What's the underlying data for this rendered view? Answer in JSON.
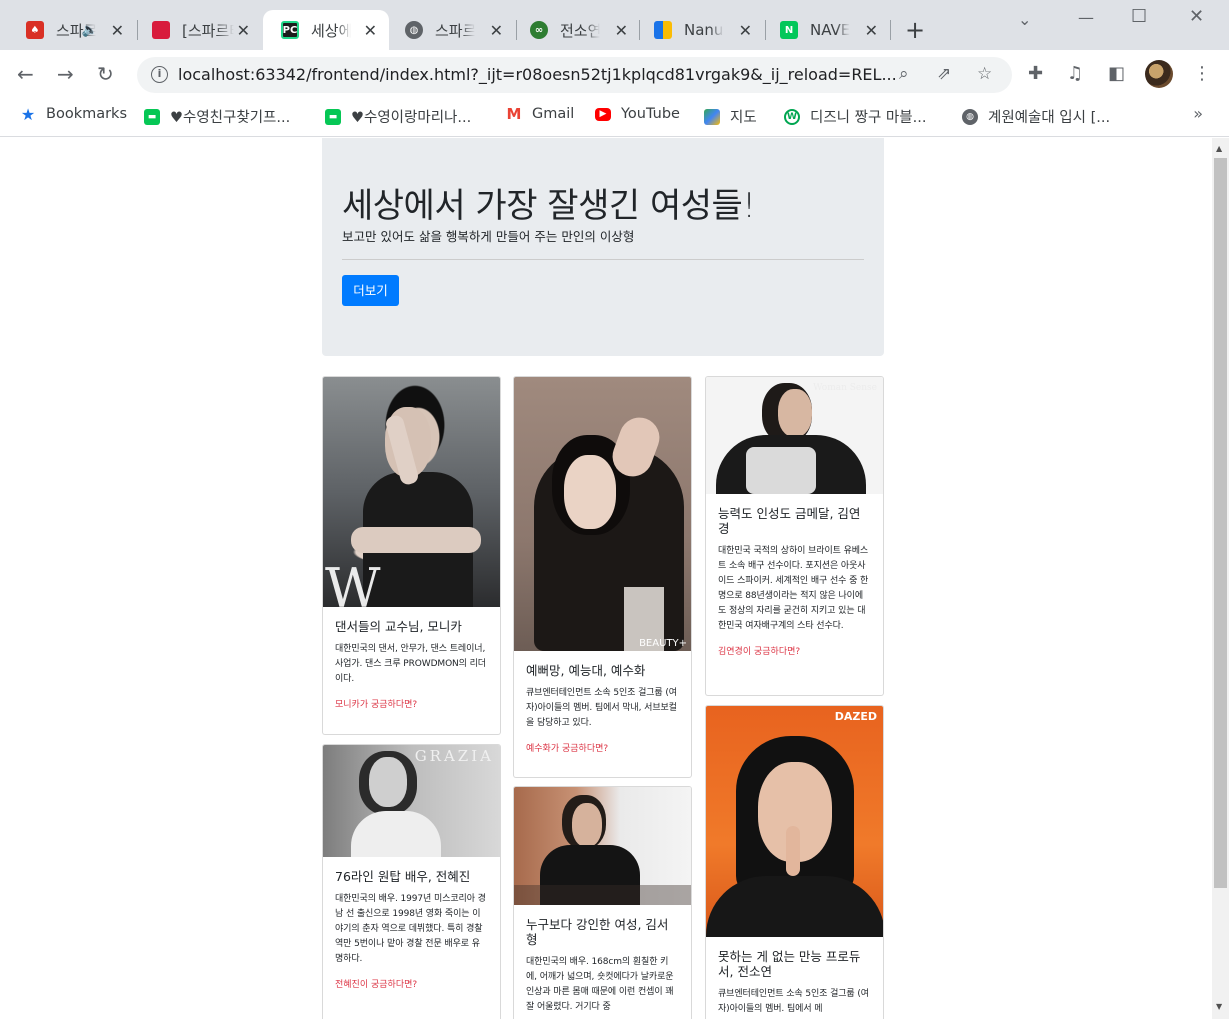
{
  "browser": {
    "tabs": [
      {
        "title": "스파르타",
        "favicon": "sparta-icon",
        "color": "#d93025",
        "audio": true
      },
      {
        "title": "[스파르타",
        "favicon": "book-icon",
        "color": "#d81b3c"
      },
      {
        "title": "세상에서",
        "favicon": "pycharm-icon",
        "color": "#1c1c1c",
        "active": true
      },
      {
        "title": "스파르타",
        "favicon": "globe-icon",
        "color": "#5f6368"
      },
      {
        "title": "전소연",
        "favicon": "scholar-icon",
        "color": "#2e7d32"
      },
      {
        "title": "Nanum",
        "favicon": "nanum-icon",
        "color": "#1a73e8"
      },
      {
        "title": "NAVER",
        "favicon": "naver-icon",
        "color": "#03c75a"
      }
    ],
    "url": "localhost:63342/frontend/index.html?_ijt=r08oesn52tj1kplqcd81vrgak9&_ij_reload=REL...",
    "bookmarks": [
      {
        "label": "Bookmarks",
        "icon": "star-icon",
        "color": "#1a73e8"
      },
      {
        "label": "♥수영친구찾기프...",
        "icon": "line-icon",
        "color": "#06c755"
      },
      {
        "label": "♥수영이랑마리나...",
        "icon": "line-icon",
        "color": "#06c755"
      },
      {
        "label": "Gmail",
        "icon": "gmail-icon",
        "color": "#ea4335"
      },
      {
        "label": "YouTube",
        "icon": "youtube-icon",
        "color": "#ff0000"
      },
      {
        "label": "지도",
        "icon": "maps-icon",
        "color": "#34a853"
      },
      {
        "label": "디즈니 짱구 마블...",
        "icon": "webtoon-icon",
        "color": "#00a651"
      },
      {
        "label": "계원예술대 입시 [...",
        "icon": "globe-icon",
        "color": "#5f6368"
      }
    ]
  },
  "page": {
    "title": "세상에서 가장 잘생긴 여성들!",
    "lead": "보고만 있어도 삶을 행복하게 만들어 주는 만인의 이상형",
    "more_button": "더보기",
    "accent": "#007bff",
    "link_color": "#dc3545",
    "cards": [
      {
        "title": "댄서들의 교수님, 모니카",
        "text": "대한민국의 댄서, 안무가, 댄스 트레이너, 사업가. 댄스 크루 PROWDMON의 리더이다.",
        "link": "모니카가 궁금하다면?",
        "watermark": "W"
      },
      {
        "title": "76라인 원탑 배우, 전혜진",
        "text": "대한민국의 배우. 1997년 미스코리아 경남 선 출신으로 1998년 영화 죽이는 이야기의 춘자 역으로 데뷔했다. 특히 경찰 역만 5번이나 맡아 경찰 전문 배우로 유명하다.",
        "link": "전혜진이 궁금하다면?",
        "watermark": "GRAZIA"
      },
      {
        "title": "예뻐망, 예능대, 예수화",
        "text": "큐브엔터테인먼트 소속 5인조 걸그룹 (여자)아이들의 멤버. 팀에서 막내, 서브보컬을 담당하고 있다.",
        "link": "예수화가 궁금하다면?",
        "watermark": "BEAUTY+"
      },
      {
        "title": "누구보다 강인한 여성, 김서형",
        "text": "대한민국의 배우. 168cm의 훤칠한 키에, 어깨가 넓으며, 숏컷에다가 날카로운 인상과 마른 몸매 때문에 이런 컨셉이 꽤 잘 어울렸다. 거기다 중",
        "link": "",
        "watermark": ""
      },
      {
        "title": "능력도 인성도 금메달, 김연경",
        "text": "대한민국 국적의 상하이 브라이트 유베스트 소속 배구 선수이다. 포지션은 아웃사이드 스파이커. 세계적인 배구 선수 중 한 명으로 88년생이라는 적지 않은 나이에도 정상의 자리를 굳건히 지키고 있는 대한민국 여자배구계의 스타 선수다.",
        "link": "김연경이 궁금하다면?",
        "watermark": "Woman Sense"
      },
      {
        "title": "못하는 게 없는 만능 프로듀서, 전소연",
        "text": "큐브엔터테인먼트 소속 5인조 걸그룹 (여자)아이들의 멤버. 팀에서 메",
        "link": "",
        "watermark": "DAZED"
      }
    ]
  }
}
